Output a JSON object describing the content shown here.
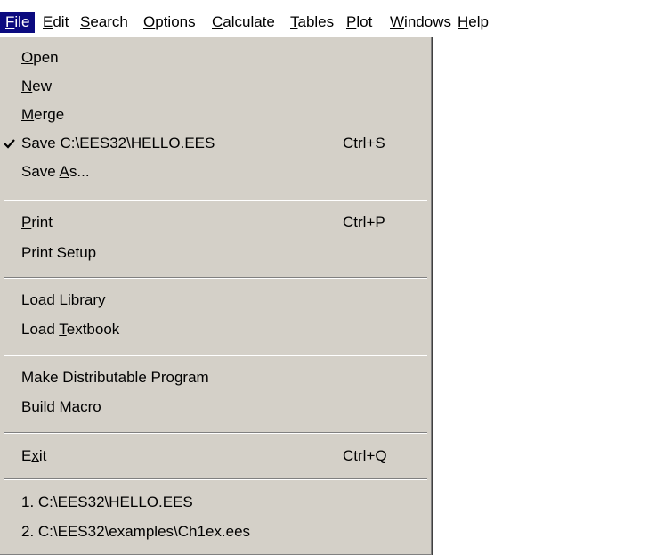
{
  "menubar": {
    "items": [
      {
        "pre": "",
        "key": "F",
        "post": "ile"
      },
      {
        "pre": "",
        "key": "E",
        "post": "dit"
      },
      {
        "pre": "",
        "key": "S",
        "post": "earch"
      },
      {
        "pre": "",
        "key": "O",
        "post": "ptions"
      },
      {
        "pre": "",
        "key": "C",
        "post": "alculate"
      },
      {
        "pre": "",
        "key": "T",
        "post": "ables"
      },
      {
        "pre": "",
        "key": "P",
        "post": "lot"
      },
      {
        "pre": "",
        "key": "W",
        "post": "indows"
      },
      {
        "pre": "",
        "key": "H",
        "post": "elp"
      }
    ],
    "active_color": "#0b0a7f"
  },
  "file_menu": {
    "items": [
      {
        "pre": "",
        "key": "O",
        "post": "pen",
        "shortcut": ""
      },
      {
        "pre": "",
        "key": "N",
        "post": "ew",
        "shortcut": ""
      },
      {
        "pre": "",
        "key": "M",
        "post": "erge",
        "shortcut": ""
      },
      {
        "pre": "Save C:\\EES32\\HELLO.EES",
        "key": "",
        "post": "",
        "shortcut": "Ctrl+S",
        "checked": true
      },
      {
        "pre": "Save ",
        "key": "A",
        "post": "s...",
        "shortcut": ""
      },
      {
        "pre": "",
        "key": "P",
        "post": "rint",
        "shortcut": "Ctrl+P"
      },
      {
        "pre": "Print Setup",
        "key": "",
        "post": "",
        "shortcut": ""
      },
      {
        "pre": "",
        "key": "L",
        "post": "oad Library",
        "shortcut": ""
      },
      {
        "pre": "Load ",
        "key": "T",
        "post": "extbook",
        "shortcut": ""
      },
      {
        "pre": "Make Distributable Program",
        "key": "",
        "post": "",
        "shortcut": ""
      },
      {
        "pre": "Build Macro",
        "key": "",
        "post": "",
        "shortcut": ""
      },
      {
        "pre": "E",
        "key": "x",
        "post": "it",
        "shortcut": "Ctrl+Q"
      },
      {
        "pre": "1. C:\\EES32\\HELLO.EES",
        "key": "",
        "post": "",
        "shortcut": ""
      },
      {
        "pre": "2. C:\\EES32\\examples\\Ch1ex.ees",
        "key": "",
        "post": "",
        "shortcut": ""
      }
    ],
    "check_icon": "checkmark-icon",
    "background": "#d4d0c8"
  }
}
